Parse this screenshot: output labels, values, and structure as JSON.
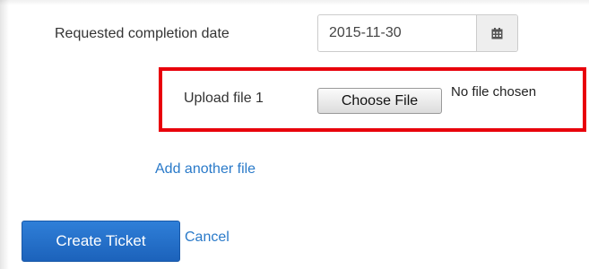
{
  "form": {
    "completion_date": {
      "label": "Requested completion date",
      "value": "2015-11-30",
      "icon": "calendar-icon"
    },
    "upload": {
      "label": "Upload file 1",
      "button_label": "Choose File",
      "status": "No file chosen"
    },
    "add_file_link": "Add another file",
    "actions": {
      "submit_label": "Create Ticket",
      "cancel_label": "Cancel"
    }
  },
  "colors": {
    "highlight_border": "#e8000b",
    "primary_button": "#1c62bb",
    "link": "#2a7ac9"
  }
}
